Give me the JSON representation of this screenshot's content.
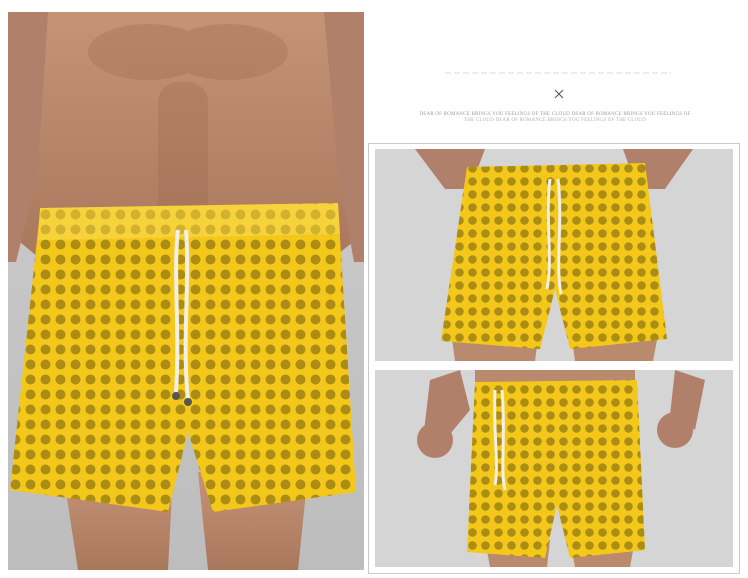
{
  "header": {
    "close_symbol": "×",
    "tagline_line1": "DEAR OF ROMANCE BRINGS YOU FEELINGS OF THE CLOUD DEAR OF ROMANCE BRINGS YOU FEELINGS OF",
    "tagline_line2": "THE CLOUD DEAR OF ROMANCE BRINGS YOU FEELINGS OF THE CLOUD"
  },
  "colors": {
    "fabric": "#f4c81a",
    "fabric_dark": "#c99a06",
    "skin": "#b98a6e",
    "background_grey": "#cfcfcf",
    "frame_border": "#c9c9c9"
  },
  "images": [
    {
      "name": "main-product-photo",
      "subject": "front view of yellow mesh shorts on model"
    },
    {
      "name": "detail-photo-front",
      "subject": "closer front view of yellow mesh shorts"
    },
    {
      "name": "detail-photo-side",
      "subject": "front view of yellow mesh shorts with arms visible"
    }
  ]
}
